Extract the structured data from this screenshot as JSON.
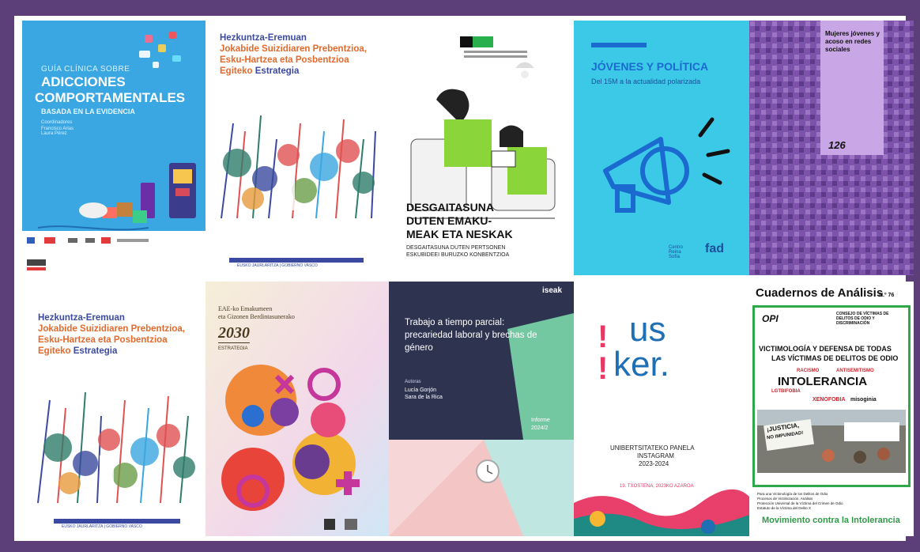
{
  "covers": {
    "c1": {
      "kicker": "GUÍA CLÍNICA SOBRE",
      "title1": "ADICCIONES",
      "title2": "COMPORTAMENTALES",
      "subtitle": "BASADA EN LA EVIDENCIA",
      "coordinator_label": "Coordinadores",
      "coordinators": "Francisco Arias\nLaura Pérez"
    },
    "c2": {
      "line1": "Hezkuntza-Eremuan",
      "line2": "Jokabide Suizidiaren Prebentzioa,",
      "line3": "Esku-Hartzea eta Posbentzioa",
      "line4a": "Egiteko",
      "line4b": "Estrategia",
      "footer": "EUSKO JAURLARITZA | GOBIERNO VASCO"
    },
    "c3": {
      "title1": "DESGAITASUNA",
      "title2": "DUTEN EMAKU-",
      "title3": "MEAK ETA NESKAK",
      "subtitle1": "DESGAITASUNA DUTEN PERTSONEN",
      "subtitle2": "ESKUBIDEEI BURUZKO KONBENTZIOA"
    },
    "c4": {
      "title": "JÓVENES Y POLÍTICA",
      "subtitle": "Del 15M a la actualidad polarizada",
      "footer_left": "Centro Reina Sofía",
      "footer_logo": "fad"
    },
    "c5": {
      "title": "Mujeres jóvenes y acoso en redes sociales",
      "number": "126"
    },
    "c6": {
      "line1": "Hezkuntza-Eremuan",
      "line2": "Jokabide Suizidiaren Prebentzioa,",
      "line3": "Esku-Hartzea eta Posbentzioa",
      "line4a": "Egiteko",
      "line4b": "Estrategia",
      "footer": "EUSKO JAURLARITZA | GOBIERNO VASCO"
    },
    "c7": {
      "line1": "EAE-ko Emakumeen",
      "line2": "eta Gizonen Berdintasunerako",
      "year": "2030",
      "label": "ESTRATEGIA"
    },
    "c8": {
      "brand": "iseak",
      "title": "Trabajo a tiempo parcial: precariedad laboral y brechas de género",
      "authors_label": "Autoras",
      "author1": "Lucía Gorjón",
      "author2": "Sara de la Rica",
      "report": "Informe",
      "report_num": "2024/2"
    },
    "c9": {
      "logo_top": "us",
      "logo_bottom": "ker.",
      "line1": "UNIBERTSITATEKO PANELA",
      "line2": "INSTAGRAM",
      "line3": "2023-2024",
      "edition": "19. TXOSTENA, 2023KO AZAROA"
    },
    "c10": {
      "title": "Cuadernos de Análisis",
      "number": "N.º 76",
      "org1": "OPI",
      "org2": "CONSEJO DE VÍCTIMAS DE DELITOS DE ODIO Y DISCRIMINACIÓN",
      "headline1": "VICTIMOLOGÍA Y DEFENSA DE TODAS",
      "headline2": "LAS VÍCTIMAS DE DELITOS DE ODIO",
      "word1": "RACISMO",
      "word2": "ANTISEMITISMO",
      "word3": "INTOLERANCIA",
      "word4": "LGTBIFOBIA",
      "word5": "XENOFOBIA",
      "word6": "misoginia",
      "sign1": "¡JUSTICIA,",
      "sign2": "NO IMPUNIDAD!",
      "bullets": [
        "Para una Victimología de los Delitos de Odio",
        "Procesos de Victimización. Análisis",
        "Protección Universal de la Víctima del Crimen de Odio",
        "Estatuto de la Víctima del Delito X"
      ],
      "footer": "Movimiento contra la Intolerancia"
    }
  }
}
